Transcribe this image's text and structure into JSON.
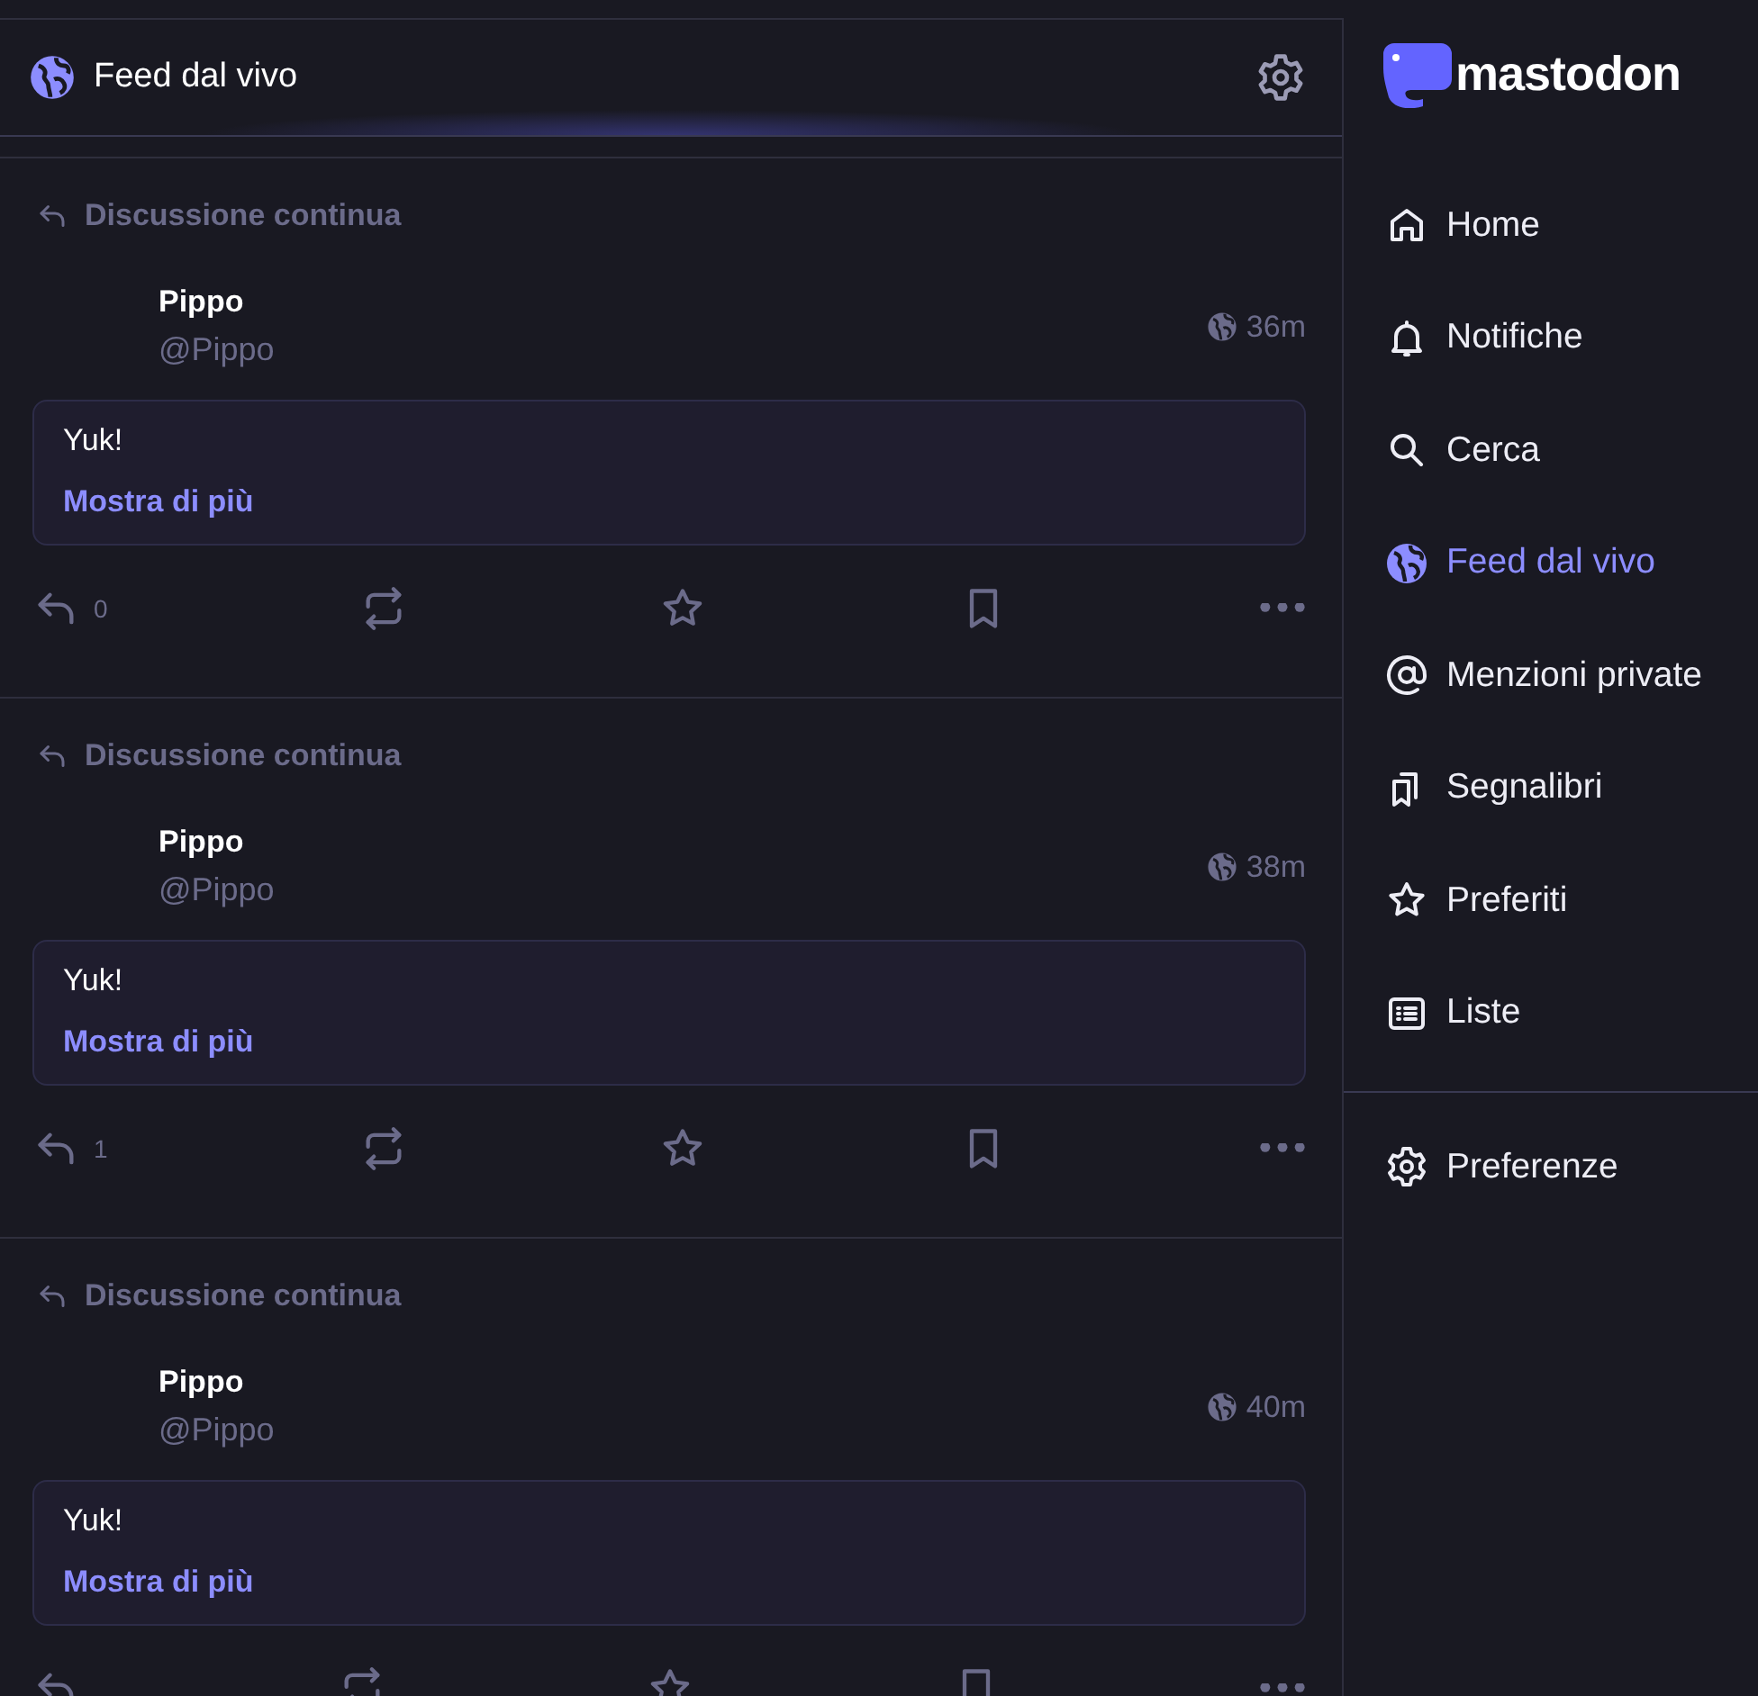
{
  "column_header": {
    "title": "Feed dal vivo"
  },
  "posts": [
    {
      "context": "Discussione continua",
      "name": "Pippo",
      "handle": "@Pippo",
      "time": "36m",
      "text": "Yuk!",
      "more": "Mostra di più",
      "replies": "0"
    },
    {
      "context": "Discussione continua",
      "name": "Pippo",
      "handle": "@Pippo",
      "time": "38m",
      "text": "Yuk!",
      "more": "Mostra di più",
      "replies": "1"
    },
    {
      "context": "Discussione continua",
      "name": "Pippo",
      "handle": "@Pippo",
      "time": "40m",
      "text": "Yuk!",
      "more": "Mostra di più"
    }
  ],
  "logo": "mastodon",
  "nav": [
    {
      "kind": "home",
      "label": "Home",
      "selected": false
    },
    {
      "kind": "bell",
      "label": "Notifiche",
      "selected": false
    },
    {
      "kind": "search",
      "label": "Cerca",
      "selected": false
    },
    {
      "kind": "globe",
      "label": "Feed dal vivo",
      "selected": true
    },
    {
      "kind": "at",
      "label": "Menzioni private",
      "selected": false
    },
    {
      "kind": "bookmarks",
      "label": "Segnalibri",
      "selected": false
    },
    {
      "kind": "star",
      "label": "Preferiti",
      "selected": false
    },
    {
      "kind": "list",
      "label": "Liste",
      "selected": false
    }
  ],
  "nav_bottom": [
    {
      "kind": "gear",
      "label": "Preferenze",
      "selected": false
    }
  ]
}
